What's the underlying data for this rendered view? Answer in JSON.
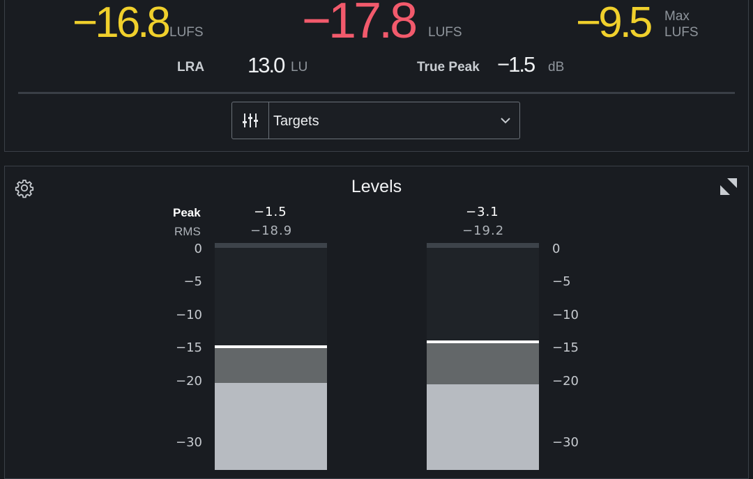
{
  "loudness": {
    "short_term": {
      "value": "−16.8",
      "unit": "LUFS"
    },
    "integrated": {
      "value": "−17.8",
      "unit": "LUFS"
    },
    "max": {
      "value": "−9.5",
      "unit_line1": "Max",
      "unit_line2": "LUFS"
    },
    "lra": {
      "label": "LRA",
      "value": "13.0",
      "unit": "LU"
    },
    "true_peak": {
      "label": "True Peak",
      "value": "−1.5",
      "unit": "dB"
    },
    "targets_label": "Targets"
  },
  "levels": {
    "title": "Levels",
    "peak_label": "Peak",
    "rms_label": "RMS",
    "channels": [
      {
        "peak": "−1.5",
        "rms": "−18.9",
        "peak_db": -14.8,
        "rms_db": -20.2
      },
      {
        "peak": "−3.1",
        "rms": "−19.2",
        "peak_db": -14.0,
        "rms_db": -20.4
      }
    ],
    "scale": [
      "0",
      "−5",
      "−10",
      "−15",
      "−20",
      "−30"
    ],
    "colors": {
      "yellow": "#f0d02c",
      "red": "#f25a6c",
      "rms_fill": "#636769",
      "low_fill": "#b7bbc1"
    }
  }
}
